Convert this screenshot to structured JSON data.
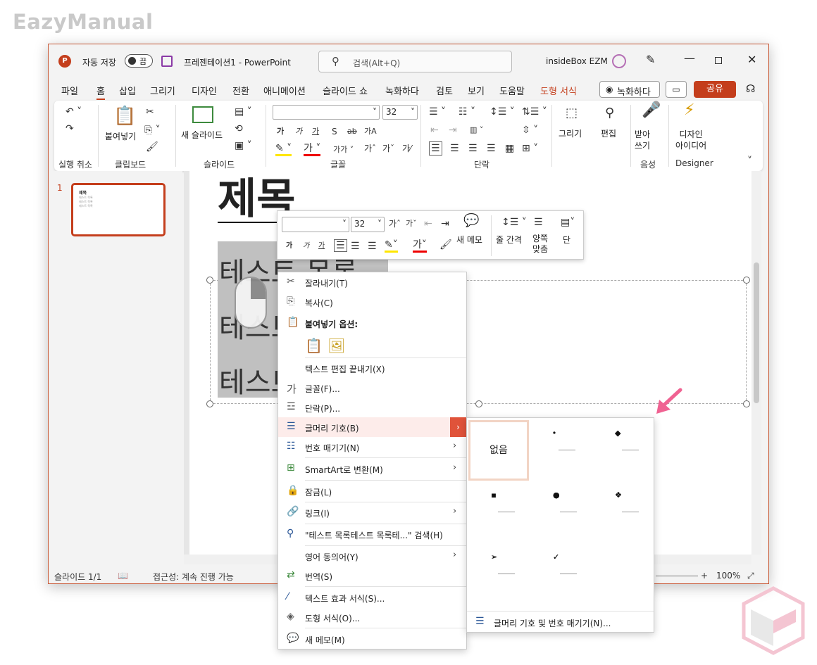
{
  "watermark": "EazyManual",
  "titlebar": {
    "autosave_label": "자동 저장",
    "autosave_state": "끔",
    "doc_title": "프레젠테이션1 - PowerPoint",
    "search_placeholder": "검색(Alt+Q)",
    "account": "insideBox EZM"
  },
  "tabs": [
    "파일",
    "홈",
    "삽입",
    "그리기",
    "디자인",
    "전환",
    "애니메이션",
    "슬라이드 쇼",
    "녹화하다",
    "검토",
    "보기",
    "도움말",
    "도형 서식"
  ],
  "record_button": "녹화하다",
  "share_button": "공유",
  "ribbon": {
    "groups": {
      "undo": "실행 취소",
      "clipboard": "클립보드",
      "slides": "슬라이드",
      "font": "글꼴",
      "paragraph": "단락",
      "voice": "음성",
      "designer": "Designer"
    },
    "paste": "붙여넣기",
    "new_slide": "새 슬라이드",
    "font_size": "32",
    "draw": "그리기",
    "edit": "편집",
    "dictate": "받아\n쓰기",
    "designer_btn": "디자인\n아이디어",
    "font_buttons": [
      "가",
      "가",
      "가",
      "S",
      "ab",
      "가A"
    ]
  },
  "thumbnail": {
    "number": "1",
    "title": "제목",
    "lines": [
      "테스트 목록",
      "테스트 목록",
      "테스트 목록"
    ]
  },
  "slide": {
    "title": "제목",
    "bullets": [
      "테스트 목록",
      "테스트",
      "테스트"
    ]
  },
  "minitoolbar": {
    "font_size": "32",
    "new_memo": "새 메모",
    "line_spacing": "줄 간격",
    "justify": "양쪽\n맞춤",
    "columns": "단"
  },
  "context_menu": [
    {
      "label": "잘라내기(T)",
      "icon": "scissors"
    },
    {
      "label": "복사(C)",
      "icon": "copy"
    },
    {
      "label": "붙여넣기 옵션:",
      "icon": "paste"
    },
    {
      "label": "텍스트 편집 끝내기(X)",
      "icon": ""
    },
    {
      "label": "글꼴(F)...",
      "icon": "가"
    },
    {
      "label": "단락(P)...",
      "icon": "paragraph"
    },
    {
      "label": "글머리 기호(B)",
      "icon": "bullets"
    },
    {
      "label": "번호 매기기(N)",
      "icon": "numbering"
    },
    {
      "label": "SmartArt로 변환(M)",
      "icon": "smartart"
    },
    {
      "label": "잠금(L)",
      "icon": "lock"
    },
    {
      "label": "링크(I)",
      "icon": "link"
    },
    {
      "label": "\"테스트 목록테스트 목록테...\" 검색(H)",
      "icon": "search"
    },
    {
      "label": "영어 동의어(Y)",
      "icon": ""
    },
    {
      "label": "번역(S)",
      "icon": "translate"
    },
    {
      "label": "텍스트 효과 서식(S)...",
      "icon": "texteffect"
    },
    {
      "label": "도형 서식(O)...",
      "icon": "shape"
    },
    {
      "label": "새 메모(M)",
      "icon": "memo"
    }
  ],
  "bullet_submenu": {
    "none": "없음",
    "glyphs": [
      "•",
      "◆",
      "▪",
      "●",
      "❖",
      "➢",
      "✓"
    ],
    "footer": "글머리 기호 및 번호 매기기(N)..."
  },
  "statusbar": {
    "slide": "슬라이드 1/1",
    "accessibility": "접근성: 계속 진행 가능",
    "zoom": "100%"
  },
  "colors": {
    "accent": "#c43e1c",
    "highlight_pink": "#f06292"
  }
}
